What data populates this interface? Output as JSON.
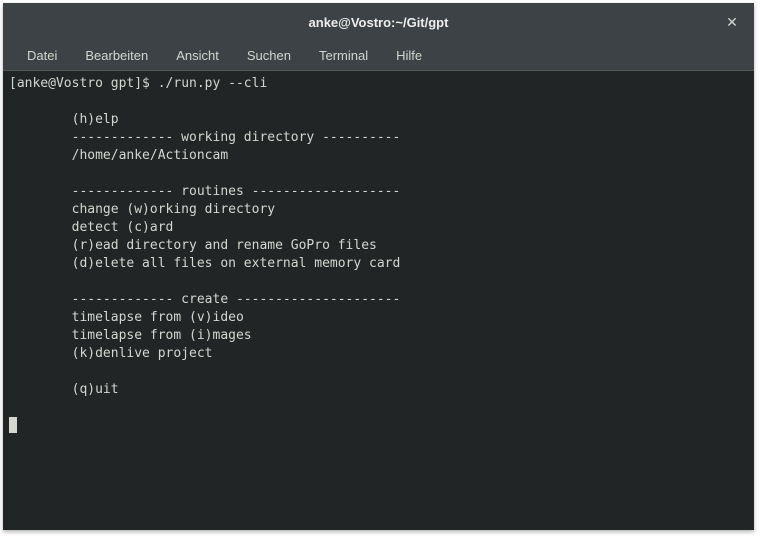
{
  "titlebar": {
    "title": "anke@Vostro:~/Git/gpt"
  },
  "menubar": {
    "items": [
      "Datei",
      "Bearbeiten",
      "Ansicht",
      "Suchen",
      "Terminal",
      "Hilfe"
    ]
  },
  "terminal": {
    "prompt": "[anke@Vostro gpt]$ ",
    "command": "./run.py --cli",
    "output_lines": [
      "",
      "        (h)elp",
      "        ------------- working directory ----------",
      "        /home/anke/Actioncam",
      "",
      "        ------------- routines -------------------",
      "        change (w)orking directory",
      "        detect (c)ard",
      "        (r)ead directory and rename GoPro files",
      "        (d)elete all files on external memory card",
      "",
      "        ------------- create ---------------------",
      "        timelapse from (v)ideo",
      "        timelapse from (i)mages",
      "        (k)denlive project",
      "",
      "        (q)uit",
      ""
    ]
  }
}
